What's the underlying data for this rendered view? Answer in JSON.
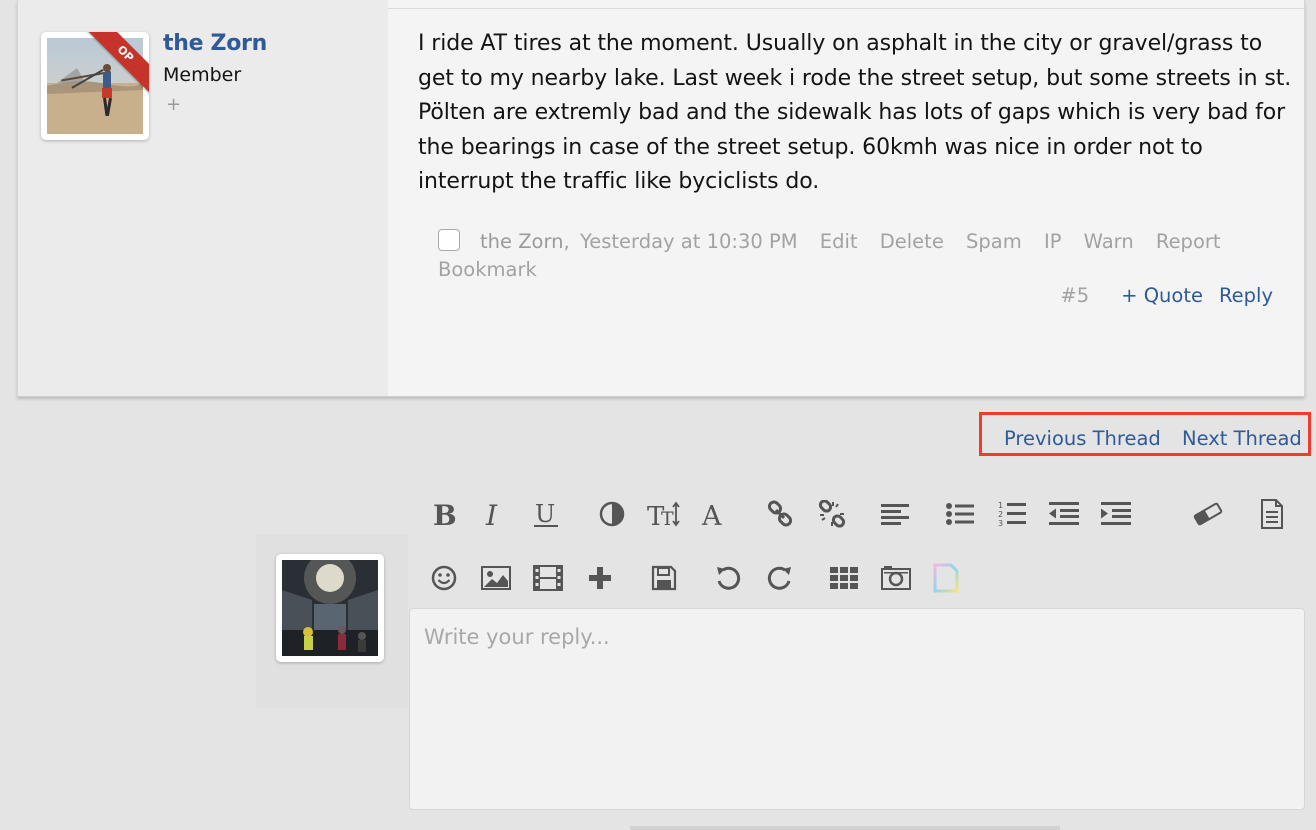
{
  "post": {
    "username": "the Zorn",
    "user_title": "Member",
    "user_extra": "+",
    "badge": "OP",
    "message": "I ride AT tires at the moment. Usually on asphalt in the city or gravel/grass to get to my nearby lake. Last week i rode the street setup, but some streets in st. Pölten are extremly bad and the sidewalk has lots of gaps which is very bad for the bearings in case of the street setup. 60kmh was nice in order not to interrupt the traffic like byciclists do.",
    "meta_author": "the Zorn",
    "meta_separator": ",",
    "meta_time": "Yesterday at 10:30 PM",
    "actions": [
      "Edit",
      "Delete",
      "Spam",
      "IP",
      "Warn",
      "Report",
      "Bookmark"
    ],
    "post_number": "#5",
    "quote_label": "+ Quote",
    "reply_label": "Reply"
  },
  "thread_nav": {
    "previous": "Previous Thread",
    "next": "Next Thread",
    "highlight_color": "#f23b2e"
  },
  "editor": {
    "placeholder": "Write your reply...",
    "toolbar_row1": [
      "bold-icon",
      "italic-icon",
      "underline-icon",
      "text-color-icon",
      "font-size-icon",
      "font-family-icon",
      "link-icon",
      "unlink-icon",
      "align-icon",
      "bullet-list-icon",
      "numbered-list-icon",
      "outdent-icon",
      "indent-icon",
      "remove-format-icon",
      "bbcode-icon"
    ],
    "toolbar_row2": [
      "smilie-icon",
      "image-icon",
      "media-icon",
      "insert-icon",
      "save-draft-icon",
      "undo-icon",
      "redo-icon",
      "grid-icon",
      "screenshot-icon",
      "new-page-icon"
    ]
  },
  "colors": {
    "link": "#2f5a98",
    "meta": "#a2a2a2",
    "ribbon": "#c6332b"
  }
}
